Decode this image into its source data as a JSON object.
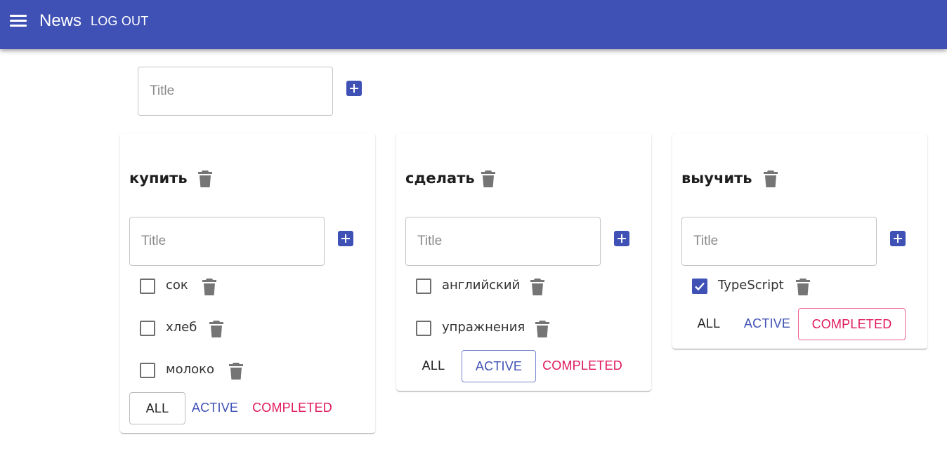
{
  "app": {
    "title": "News",
    "logout_label": "LOG OUT"
  },
  "new_list": {
    "placeholder": "Title"
  },
  "filters": {
    "all": "ALL",
    "active": "ACTIVE",
    "completed": "COMPLETED"
  },
  "lists": [
    {
      "title": "купить",
      "placeholder": "Title",
      "selected_filter": "all",
      "tasks": [
        {
          "label": "сок",
          "done": false
        },
        {
          "label": "хлеб",
          "done": false
        },
        {
          "label": "молоко",
          "done": false
        }
      ]
    },
    {
      "title": "сделать",
      "placeholder": "Title",
      "selected_filter": "active",
      "tasks": [
        {
          "label": "английский",
          "done": false
        },
        {
          "label": "упражнения",
          "done": false
        }
      ]
    },
    {
      "title": "выучить",
      "placeholder": "Title",
      "selected_filter": "completed",
      "tasks": [
        {
          "label": "TypeScript",
          "done": true
        }
      ]
    }
  ],
  "colors": {
    "primary": "#3f51b5",
    "secondary": "#e0185a",
    "icon_gray": "#757575"
  }
}
